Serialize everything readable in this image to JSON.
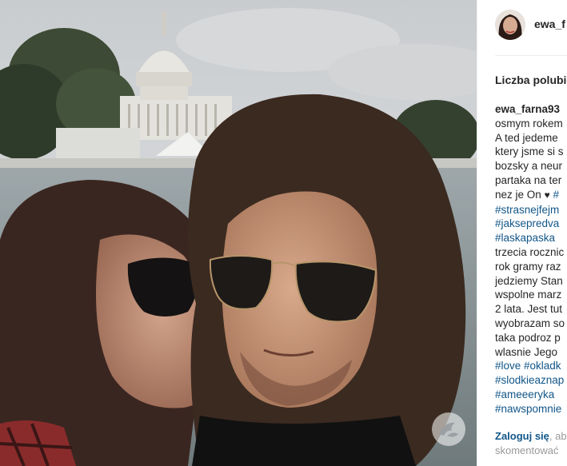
{
  "post": {
    "username": "ewa_f",
    "likes_label": "Liczba polubie",
    "caption_author": "ewa_farna93",
    "caption_lines": [
      "osmym rokem",
      "A ted jedeme",
      "ktery jsme si s",
      "bozsky a neur",
      "partaka na ter",
      "nez je On"
    ],
    "heart": "♥",
    "hashtag_inline": "#",
    "hashtags_1": [
      "#strasnejfejm",
      "#jaksepredva",
      "#laskapaska"
    ],
    "caption_lines_2": [
      "trzecia rocznic",
      "rok gramy raz",
      "jedziemy Stan",
      "wspolne marz",
      "2 lata. Jest tut",
      "wyobrazam so",
      "taka podroz p",
      "wlasnie Jego"
    ],
    "hashtag_love_line": "#love #okladk",
    "hashtags_2": [
      "#slodkieaznap",
      "#ameeeryka",
      "#nawspomnie"
    ],
    "footer_login": "Zaloguj się",
    "footer_rest": ", ab",
    "footer_line2": "skomentować"
  },
  "colors": {
    "hashtag": "#125688",
    "text": "#262626",
    "muted": "#999999"
  },
  "icons": {
    "avatar": "profile-avatar",
    "watermark": "bird-logo-watermark"
  }
}
